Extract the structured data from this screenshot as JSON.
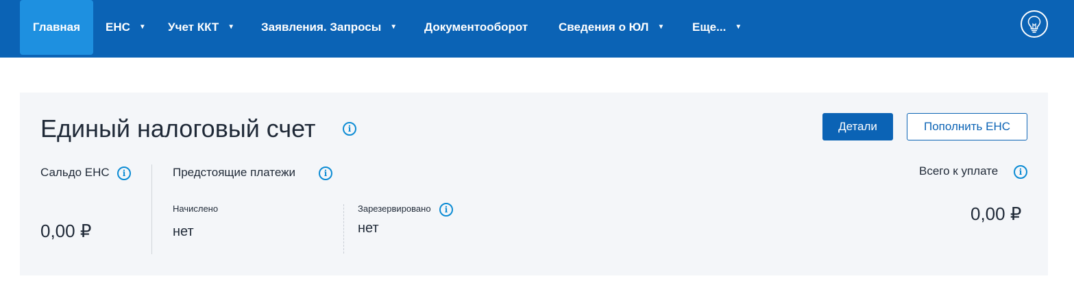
{
  "nav": {
    "items": [
      {
        "label": "Главная",
        "caret": false,
        "active": true
      },
      {
        "label": "ЕНС",
        "caret": true
      },
      {
        "label": "Учет ККТ",
        "caret": true
      },
      {
        "label": "Заявления. Запросы",
        "caret": true
      },
      {
        "label": "Документооборот",
        "caret": false
      },
      {
        "label": "Сведения о ЮЛ",
        "caret": true
      },
      {
        "label": "Еще...",
        "caret": true
      }
    ],
    "help_icon": "lightbulb-icon"
  },
  "ens": {
    "title": "Единый налоговый счет",
    "details_button": "Детали",
    "topup_button": "Пополнить ЕНС",
    "saldo": {
      "label": "Сальдо ЕНС",
      "amount": "0,00 ₽"
    },
    "upcoming": {
      "label": "Предстоящие платежи",
      "accrued_label": "Начислено",
      "accrued_value": "нет",
      "reserved_label": "Зарезервировано",
      "reserved_value": "нет"
    },
    "total": {
      "label": "Всего к уплате",
      "amount": "0,00 ₽"
    }
  },
  "colors": {
    "nav_bg": "#0b63b5",
    "nav_active": "#1e90e0",
    "accent": "#0b8bd4",
    "card_bg": "#f4f6f9"
  }
}
